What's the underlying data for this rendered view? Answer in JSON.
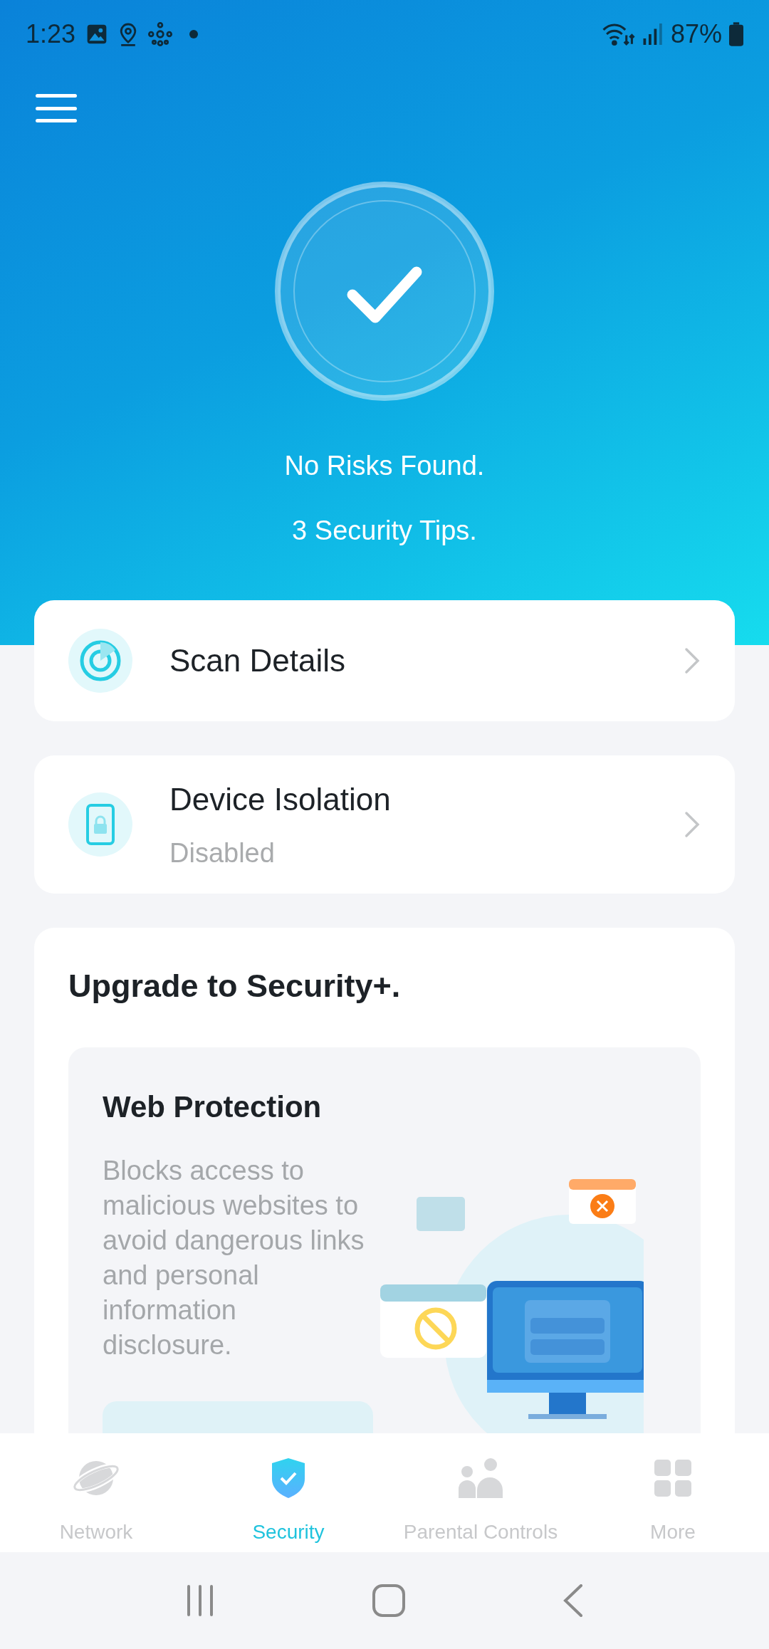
{
  "status_bar": {
    "time": "1:23",
    "battery": "87%"
  },
  "hero": {
    "status": "No Risks Found.",
    "tips": "3 Security Tips."
  },
  "menu_items": [
    {
      "kind": "scan",
      "title": "Scan Details"
    },
    {
      "kind": "isolation",
      "title": "Device Isolation",
      "subtitle": "Disabled"
    }
  ],
  "upgrade": {
    "title": "Upgrade to Security+.",
    "feature": {
      "title": "Web Protection",
      "description": "Blocks access to malicious websites to avoid dangerous links and personal information disclosure."
    }
  },
  "tabs": [
    {
      "kind": "network",
      "label": "Network",
      "selected": false
    },
    {
      "kind": "security",
      "label": "Security",
      "selected": true
    },
    {
      "kind": "parental",
      "label": "Parental Controls",
      "selected": false
    },
    {
      "kind": "more",
      "label": "More",
      "selected": false
    }
  ]
}
